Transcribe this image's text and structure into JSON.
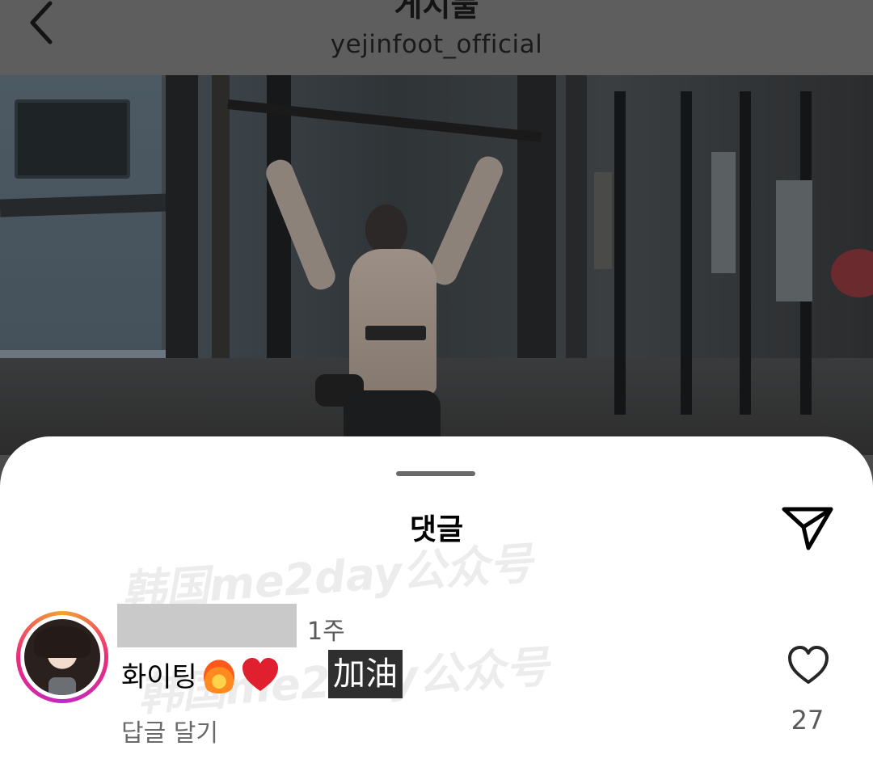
{
  "header": {
    "title": "게시물",
    "username": "yejinfoot_official",
    "back_icon": "chevron-left-icon"
  },
  "comments_sheet": {
    "title": "댓글",
    "share_icon": "paper-plane-icon",
    "watermark": "韩国me2day公众号",
    "comments": [
      {
        "username": "",
        "time": "1주",
        "text": "화이팅",
        "emojis": [
          "fire",
          "red-heart"
        ],
        "translation": "加油",
        "likes": "27",
        "reply_label": "답글 달기"
      }
    ]
  },
  "colors": {
    "overlay": "#5e5e5e",
    "sheet_bg": "#ffffff",
    "ring_start": "#f3a22c",
    "ring_mid": "#ee2a7b",
    "heart_red": "#e0202f"
  }
}
